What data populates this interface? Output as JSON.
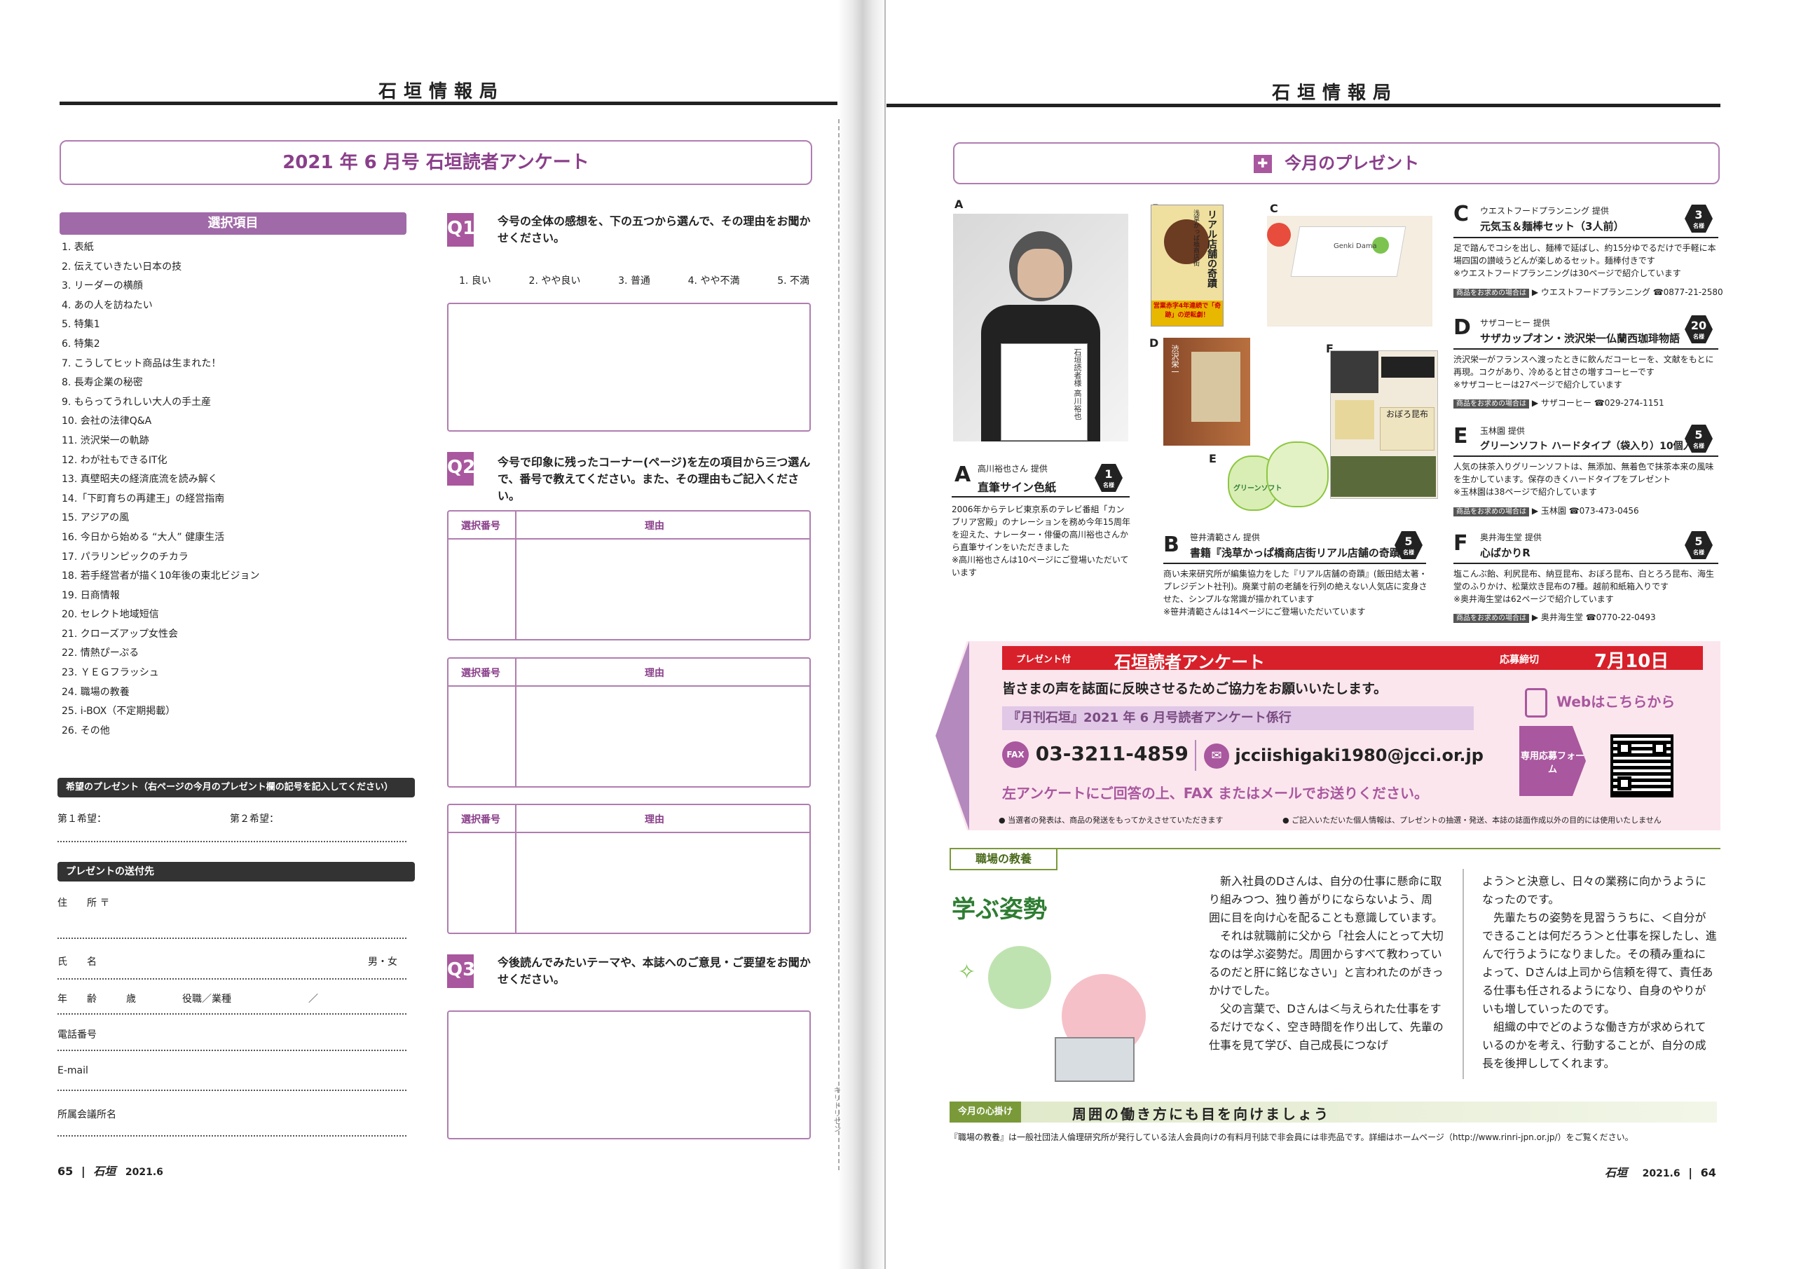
{
  "header": {
    "left_title": "石垣情報局",
    "right_title": "石垣情報局"
  },
  "left": {
    "survey_title": "2021 年 6 月号  石垣読者アンケート",
    "selection_header": "選択項目",
    "items": [
      "1.  表紙",
      "2.  伝えていきたい日本の技",
      "3.  リーダーの横顔",
      "4.  あの人を訪ねたい",
      "5.  特集1",
      "6.  特集2",
      "7.  こうしてヒット商品は生まれた！",
      "8.  長寿企業の秘密",
      "9.  もらってうれしい大人の手土産",
      "10.  会社の法律Q&A",
      "11.  渋沢栄一の軌跡",
      "12.  わが社もできるIT化",
      "13.  真壁昭夫の経済底流を読み解く",
      "14.「下町育ちの再建王」の経営指南",
      "15.  アジアの風",
      "16.  今日から始める “大人” 健康生活",
      "17.  パラリンピックのチカラ",
      "18.  若手経営者が描く10年後の東北ビジョン",
      "19.  日商情報",
      "20.  セレクト地域短信",
      "21.  クローズアップ女性会",
      "22.  情熱ぴーぷる",
      "23.  ＹＥＧフラッシュ",
      "24.  職場の教養",
      "25.  i-BOX（不定期掲載）",
      "26.  その他"
    ],
    "present_wish_header": "希望のプレゼント（右ページの今月のプレゼント欄の記号を記入してください）",
    "wish1": "第１希望：",
    "wish2": "第２希望：",
    "destination_header": "プレゼントの送付先",
    "address_label": "住　　所 〒",
    "name_label": "氏　　名",
    "gender_label": "男・女",
    "age_label": "年　　齢　　　歳",
    "position_label": "役職／業種",
    "slash": "／",
    "phone_label": "電話番号",
    "email_label": "E-mail",
    "chamber_label": "所属会議所名",
    "q1": {
      "mark": "Q1",
      "text": "今号の全体の感想を、下の五つから選んで、その理由をお聞かせください。",
      "options": [
        "1. 良い",
        "2. やや良い",
        "3. 普通",
        "4. やや不満",
        "5. 不満"
      ]
    },
    "q2": {
      "mark": "Q2",
      "text": "今号で印象に残ったコーナー(ページ)を左の項目から三つ選んで、番号で教えてください。また、その理由もご記入ください。"
    },
    "col_number": "選択番号",
    "col_reason": "理由",
    "q3": {
      "mark": "Q3",
      "text": "今後読んでみたいテーマや、本誌へのご意見・ご要望をお聞かせください。"
    },
    "footer_page": "65",
    "footer_brand": "石垣",
    "footer_issue": "2021.6",
    "cut_text": "キリトリセン"
  },
  "right": {
    "present_title": "今月のプレゼント",
    "A": {
      "letter": "A",
      "provider": "高川裕也さん 提供",
      "title": "直筆サイン色紙",
      "count": "1",
      "unit": "名様",
      "desc": "2006年からテレビ東京系のテレビ番組「カンブリア宮殿」のナレーションを務め今年15周年を迎えた、ナレーター・俳優の高川裕也さんから直筆サインをいただきました\n※高川裕也さんは10ページにご登場いただいています"
    },
    "B": {
      "letter": "B",
      "provider": "笹井清範さん 提供",
      "title": "書籍『浅草かっぱ橋商店街リアル店舗の奇蹟』",
      "count": "5",
      "unit": "名様",
      "desc": "商い未来研究所が編集協力をした『リアル店舗の奇蹟』(飯田結太著・プレジデント社刊)。廃業寸前の老舗を行列の絶えない人気店に変身させた、シンプルな常識が描かれています\n※笹井清範さんは14ページにご登場いただいています"
    },
    "C": {
      "letter": "C",
      "provider": "ウエストフードプランニング 提供",
      "title": "元気玉＆麺棒セット（3人前）",
      "count": "3",
      "unit": "名様",
      "desc": "足で踏んでコシを出し、麺棒で延ばし、約15分ゆでるだけで手軽に本場四国の讃岐うどんが楽しめるセット。麺棒付きです\n※ウエストフードプランニングは30ページで紹介しています",
      "shop_label": "商品をお求めの場合は",
      "shop": "ウエストフードプランニング",
      "tel": "☎0877-21-2580"
    },
    "D": {
      "letter": "D",
      "provider": "サザコーヒー 提供",
      "title": "サザカップオン・渋沢栄一仏蘭西珈琲物語",
      "count": "20",
      "unit": "名様",
      "desc": "渋沢栄一がフランスへ渡ったときに飲んだコーヒーを、文献をもとに再現。コクがあり、冷めると甘さの増すコーヒーです\n※サザコーヒーは27ページで紹介しています",
      "shop_label": "商品をお求めの場合は",
      "shop": "サザコーヒー",
      "tel": "☎029-274-1151"
    },
    "E": {
      "letter": "E",
      "provider": "玉林園 提供",
      "title": "グリーンソフト ハードタイプ（袋入り）10個入り",
      "count": "5",
      "unit": "名様",
      "desc": "人気の抹茶入りグリーンソフトは、無添加、無着色で抹茶本来の風味を生かしています。保存のきくハードタイプをプレゼント\n※玉林園は38ページで紹介しています",
      "shop_label": "商品をお求めの場合は",
      "shop": "玉林園",
      "tel": "☎073-473-0456"
    },
    "F": {
      "letter": "F",
      "provider": "奥井海生堂 提供",
      "title": "心ばかりR",
      "count": "5",
      "unit": "名様",
      "desc": "塩こんぶ飴、利尻昆布、納豆昆布、おぼろ昆布、白とろろ昆布、海生堂のふりかけ、松葉炊き昆布の7種。越前和紙箱入りです\n※奥井海生堂は62ページで紹介しています",
      "shop_label": "商品をお求めの場合は",
      "shop": "奥井海生堂",
      "tel": "☎0770-22-0493"
    },
    "photo_book_title": "リアル店舗の奇蹟",
    "photo_book_sub": "浅草かっぱ橋商店街",
    "photo_book_band": "営業赤字4年連続で「奇跡」の逆転劇！",
    "photo_box_brand": "Genki Dama",
    "photo_e_label": "グリーンソフト",
    "photo_f_label": "おぼろ昆布",
    "photo_d_label": "渋沢栄一",
    "photo_shikishi": "石垣読者様 高川裕也",
    "survey": {
      "present_tag": "プレゼント付",
      "title": "石垣読者アンケート",
      "deadline_label": "応募締切",
      "deadline": "7月10日",
      "lead": "皆さまの声を誌面に反映させるためご協力をお願いいたします。",
      "dept": "『月刊石垣』2021 年 6 月号読者アンケート係行",
      "fax_label": "FAX",
      "fax": "03-3211-4859",
      "email": "jcciishigaki1980@jcci.or.jp",
      "instruction": "左アンケートにご回答の上、FAX またはメールでお送りください。",
      "web": "Webはこちらから",
      "form": "専用応募フォーム",
      "note1": "● 当選者の発表は、商品の発送をもってかえさせていただきます",
      "note2": "● ご記入いただいた個人情報は、プレゼントの抽選・発送、本誌の誌面作成以外の目的には使用いたしません"
    },
    "column": {
      "tag": "職場の教養",
      "title": "学ぶ姿勢",
      "col1": "　新入社員のDさんは、自分の仕事に懸命に取り組みつつ、独り善がりにならないよう、周囲に目を向け心を配ることも意識しています。\n　それは就職前に父から「社会人にとって大切なのは学ぶ姿勢だ。周囲からすべて教わっているのだと肝に銘じなさい」と言われたのがきっかけでした。\n　父の言葉で、Dさんは＜与えられた仕事をするだけでなく、空き時間を作り出して、先輩の仕事を見て学び、自己成長につなげ",
      "col2": "よう＞と決意し、日々の業務に向かうようになったのです。\n　先輩たちの姿勢を見習ううちに、＜自分ができることは何だろう＞と仕事を探したし、進んで行うようになりました。その積み重ねによって、Dさんは上司から信頼を得て、責任ある仕事も任されるようになり、自身のやりがいも増していったのです。\n　組織の中でどのような働き方が求められているのかを考え、行動することが、自分の成長を後押ししてくれます。",
      "tip_tag": "今月の心掛け",
      "tip": "周囲の働き方にも目を向けましょう",
      "footnote": "『職場の教養』は一般社団法人倫理研究所が発行している法人会員向けの有料月刊誌で非会員には非売品です。詳細はホームページ（http://www.rinri-jpn.or.jp/）をご覧ください。"
    },
    "footer_brand": "石垣",
    "footer_issue": "2021.6",
    "footer_page": "64"
  },
  "colors": {
    "purple": "#8a3f8a",
    "red": "#d8202a",
    "pink": "#fbe6ee"
  }
}
